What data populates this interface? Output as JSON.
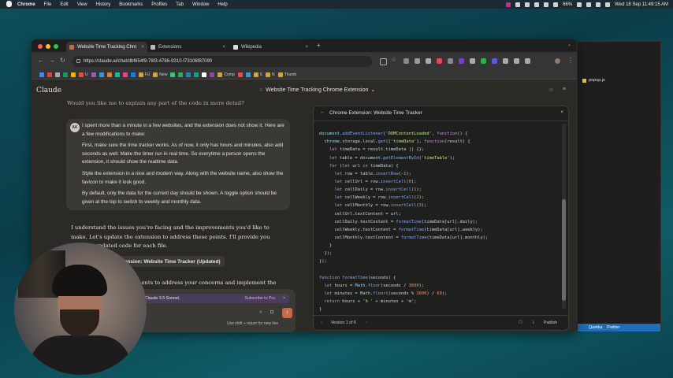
{
  "menubar": {
    "app": "Chrome",
    "items": [
      "File",
      "Edit",
      "View",
      "History",
      "Bookmarks",
      "Profiles",
      "Tab",
      "Window",
      "Help"
    ],
    "battery": "66%",
    "datetime": "Wed 18 Sep  11:49:15 AM"
  },
  "browser": {
    "tabs": [
      {
        "title": "Website Time Tracking Chro",
        "active": true,
        "favicon_color": "#c66a4a"
      },
      {
        "title": "Extensions",
        "active": false,
        "favicon_color": "#bbbbbb"
      },
      {
        "title": "Wikipedia",
        "active": false,
        "favicon_color": "#dddddd"
      }
    ],
    "url": "https://claude.ai/chat/dbf654f9-76f3-4786-9310-f73106f87090",
    "bookmarks": [
      {
        "label": "",
        "color": "#4285f4"
      },
      {
        "label": "",
        "color": "#db4437"
      },
      {
        "label": "",
        "color": "#aaaaaa"
      },
      {
        "label": "",
        "color": "#0f9d58"
      },
      {
        "label": "",
        "color": "#f4b400"
      },
      {
        "label": "U",
        "color": "#e74c3c"
      },
      {
        "label": "",
        "color": "#9b59b6"
      },
      {
        "label": "",
        "color": "#3498db"
      },
      {
        "label": "",
        "color": "#e67e22"
      },
      {
        "label": "",
        "color": "#1abc9c"
      },
      {
        "label": "",
        "color": "#e84393"
      },
      {
        "label": "",
        "color": "#0984e3"
      },
      {
        "label": "FU",
        "color": "#d4a23a"
      },
      {
        "label": "New",
        "color": "#d4a23a"
      },
      {
        "label": "",
        "color": "#2ecc71"
      },
      {
        "label": "",
        "color": "#27ae60"
      },
      {
        "label": "",
        "color": "#2980b9"
      },
      {
        "label": "",
        "color": "#16a085"
      },
      {
        "label": "",
        "color": "#ffffff"
      },
      {
        "label": "",
        "color": "#8e44ad"
      },
      {
        "label": "Comp",
        "color": "#d4a23a"
      },
      {
        "label": "",
        "color": "#e74c3c"
      },
      {
        "label": "",
        "color": "#3498db"
      },
      {
        "label": "S",
        "color": "#d4a23a"
      },
      {
        "label": "N",
        "color": "#d4a23a"
      },
      {
        "label": "Thumb",
        "color": "#d4a23a"
      }
    ]
  },
  "claude": {
    "brand": "Claude",
    "conversation_title": "Website Time Tracking Chrome Extension",
    "previous_question": "Would you like me to explain any part of the code in more detail?",
    "user_initials": "AK",
    "user_message": {
      "p1": "I spent more than a minute in a few websites, and the extension does not show it. Here are a few modifications to make:",
      "p2": "First, make sure the time tracker works. As of now, it only has hours and minutes, also add seconds as well. Make the timer run in real time. So everytime a person opens the extension, it should show the realtime data.",
      "p3": "Style the extension in a nice and modern way. Along with the website name, also show the favicon to make it look good.",
      "p4": "By default, only the data for the current day should be shown. A toggle option should be given at the top to switch to weekly and monthly data."
    },
    "reply_p1": "I understand the issues you're facing and the improvements you'd like to make. Let's update the extension to address these points. I'll provide you with the updated code for each file.",
    "artifact_card": "Extension: Website Time Tracker (Updated)",
    "reply_p2": "ments to address your concerns and implement the",
    "upsell_text": "Claude 3.5 Sonnet.",
    "upsell_link": "Subscribe to Pro",
    "input_hint": "Use  shift + return  for new line"
  },
  "artifact": {
    "title": "Chrome Extension: Website Time Tracker",
    "version": "Version 1 of 6",
    "publish": "Publish",
    "scroll_fraction": 0.9
  },
  "editor": {
    "tab": "popup.js",
    "status": [
      "Quokka",
      "Prettier"
    ]
  }
}
